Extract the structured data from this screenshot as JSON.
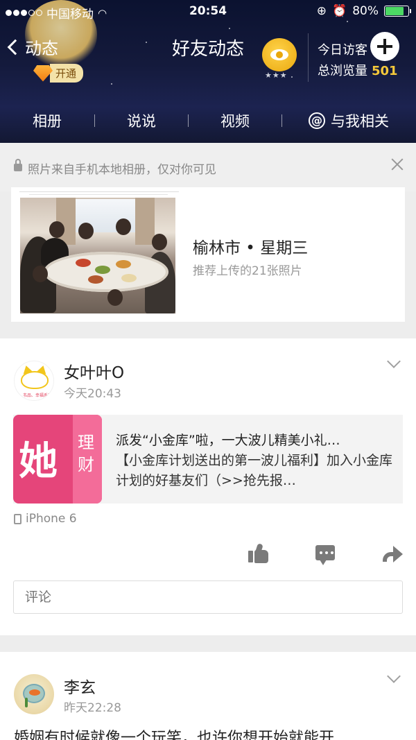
{
  "status_bar": {
    "carrier": "中国移动",
    "time": "20:54",
    "battery": "80%"
  },
  "header": {
    "back_label": "动态",
    "title": "好友动态",
    "vip_label": "开通",
    "visitors_today_label": "今日访客",
    "total_views_label": "总浏览量",
    "total_views_count": "501",
    "eye_stars": "★★★"
  },
  "tabs": [
    {
      "label": "相册"
    },
    {
      "label": "说说"
    },
    {
      "label": "视频"
    },
    {
      "label": "与我相关",
      "icon": "at-icon"
    }
  ],
  "photo_suggestion": {
    "notice": "照片来自手机本地相册，仅对你可见",
    "place": "榆林市 • 星期三",
    "subtitle": "推荐上传的21张照片"
  },
  "post1": {
    "name": "女叶叶O",
    "time": "今天20:43",
    "avatar_caption": "韦品、幸福系列",
    "share": {
      "thumb_big": "她",
      "thumb_small": "理财",
      "title": "派发“小金库”啦，一大波儿精美小礼…",
      "desc": "【小金库计划送出的第一波儿福利】加入小金库计划的好基友们（>>抢先报…"
    },
    "device": "iPhone 6",
    "comment_placeholder": "评论"
  },
  "post2": {
    "name": "李玄",
    "time": "昨天22:28",
    "text": "婚姻有时候就像一个玩笑，也许你想开始就能开"
  },
  "colors": {
    "header_bg": "#141a3c",
    "accent_gold": "#f5c83a",
    "vip_orange": "#f07c12",
    "share_pink": "#e5457a"
  }
}
